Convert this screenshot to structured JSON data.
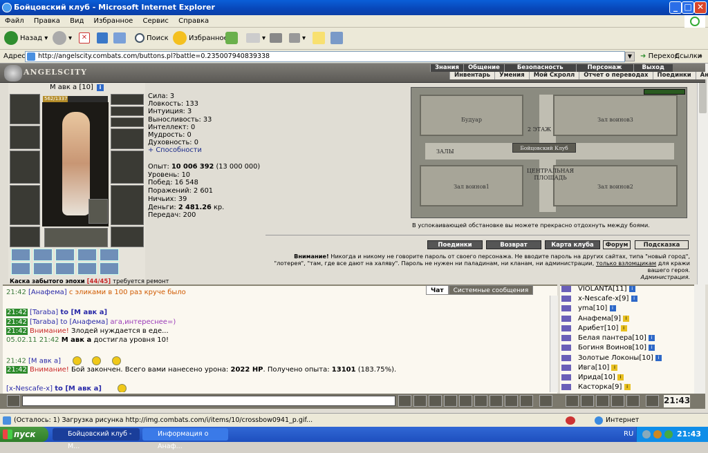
{
  "window": {
    "title": "Бойцовский клуб - Microsoft Internet Explorer"
  },
  "menu": [
    "Файл",
    "Правка",
    "Вид",
    "Избранное",
    "Сервис",
    "Справка"
  ],
  "toolbar": {
    "back": "Назад",
    "search": "Поиск",
    "favorites": "Избранное"
  },
  "address": {
    "label": "Адрес:",
    "url": "http://angelscity.combats.com/buttons.pl?battle=0.235007940839338",
    "go": "Переход",
    "links": "Ссылки"
  },
  "site": {
    "logo": "ANGELSCITY",
    "nav_top": [
      "Знания",
      "Общение",
      "Безопасность",
      "Персонаж",
      "Выход"
    ],
    "nav_bottom": [
      "Инвентарь",
      "Умения",
      "Мой Скролл",
      "Отчет о переводах",
      "Поединки",
      "Анкета"
    ]
  },
  "character": {
    "name": "М авк а",
    "level": "[10]",
    "hp": "562/1337",
    "stats": [
      "Сила: 3",
      "Ловкость: 133",
      "Интуиция: 3",
      "Выносливость: 33",
      "Интеллект: 0",
      "Мудрость: 0",
      "Духовность: 0"
    ],
    "abilities": "+ Способности",
    "exp_label": "Опыт:",
    "exp_value": "10 006 392",
    "exp_next": "(13 000 000)",
    "level_line": "Уровень: 10",
    "wins": "Побед: 16 548",
    "losses": "Поражений: 2 601",
    "draws": "Ничьих: 39",
    "money_label": "Деньги:",
    "money_value": "2 481.26",
    "money_unit": "кр.",
    "transfers": "Передач: 200",
    "carried_label": "Каска забытого эпохи",
    "carried_count": "[44/45]",
    "carried_note": "требуется ремонт"
  },
  "map": {
    "rooms": {
      "boudoir": "Будуар",
      "floor2": "2 ЭТАЖ",
      "club": "Бойцовский Клуб",
      "halls": "ЗАЛЫ",
      "square": "ЦЕНТРАЛЬНАЯ ПЛОЩАДЬ",
      "w3": "Зал воинов3",
      "w1": "Зал воинов1",
      "w2": "Зал воинов2"
    },
    "note": "В успокаивающей обстановке вы можете прекрасно отдохнуть между боями."
  },
  "actions": [
    "Поединки",
    "Возврат",
    "Карта клуба",
    "Форум",
    "Подсказка"
  ],
  "warning": {
    "bold": "Внимание!",
    "text": "Никогда и никому не говорите пароль от своего персонажа. Не вводите пароль на других сайтах, типа \"новый город\", \"лотерея\", \"там, где все дают на халяву\". Пароль не нужен ни паладинам, ни кланам, ни администрации,",
    "link": "только взломщикам",
    "tail": "для кражи вашего героя.",
    "sign": "Администрация."
  },
  "chat": {
    "tabs": [
      "Чат",
      "Системные сообщения"
    ],
    "lines": [
      {
        "t": "21:42",
        "who": "[Анафема]",
        "msg": "с эликами в 100 раз круче было"
      },
      {
        "t": "21:42",
        "who": "[Taraba]",
        "to": "to [М авк а]"
      },
      {
        "t": "21:42",
        "who": "[Taraba]",
        "to": "to [Анафема]",
        "msg": "ага,интереснее=)"
      },
      {
        "t": "21:42",
        "sys": "Внимание!",
        "msg": "Злодей нуждается в еде..."
      },
      {
        "date": "05.02.11",
        "t": "21:42",
        "name": "М авк а",
        "msg": "достигла уровня 10!"
      },
      {
        "t": "21:42",
        "who": "[М авк а]"
      },
      {
        "t": "21:42",
        "sys": "Внимание!",
        "msg": "Бой закончен. Всего вами нанесено урона:",
        "dmg": "2022 HP",
        "msg2": ". Получено опыта:",
        "xp": "13101",
        "pct": "(183.75%)."
      },
      {
        "who": "[x-Nescafe-x]",
        "to": "to [М авк а]"
      }
    ]
  },
  "users": [
    {
      "name": "VIOLANTA",
      "lvl": "[11]"
    },
    {
      "name": "x-Nescafe-x",
      "lvl": "[9]"
    },
    {
      "name": "yma",
      "lvl": "[10]"
    },
    {
      "name": "Анафема",
      "lvl": "[9]"
    },
    {
      "name": "Арибет",
      "lvl": "[10]"
    },
    {
      "name": "Белая пантера",
      "lvl": "[10]"
    },
    {
      "name": "Богиня Воинов",
      "lvl": "[10]"
    },
    {
      "name": "Золотые Локоны",
      "lvl": "[10]"
    },
    {
      "name": "Ивга",
      "lvl": "[10]"
    },
    {
      "name": "Ирида",
      "lvl": "[10]"
    },
    {
      "name": "Касторка",
      "lvl": "[9]"
    }
  ],
  "clock": "21:43",
  "status": {
    "text": "(Осталось: 1) Загрузка рисунка http://img.combats.com/i/items/10/crossbow0941_p.gif...",
    "zone": "Интернет"
  },
  "taskbar": {
    "start": "пуск",
    "tasks": [
      "Бойцовский клуб - М...",
      "Информация о Анаф..."
    ],
    "lang": "RU",
    "time": "21:43"
  }
}
